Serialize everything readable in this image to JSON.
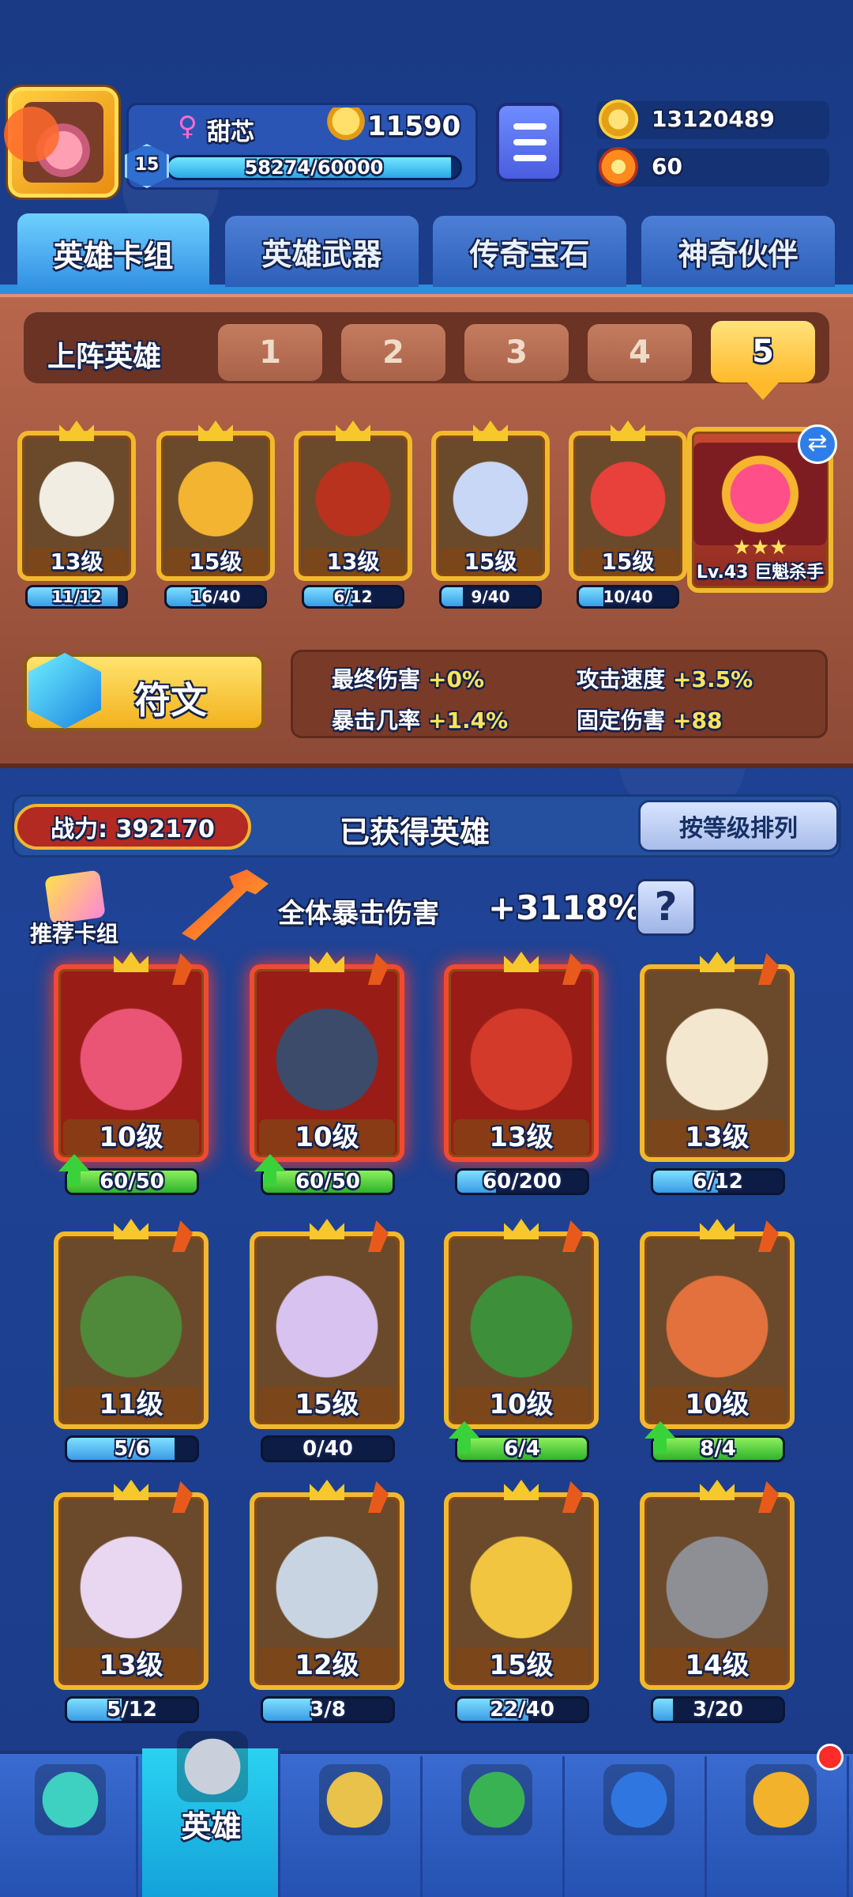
{
  "player": {
    "name": "甜芯",
    "trophies": "11590",
    "level": "15",
    "xp": "58274/60000",
    "xp_fraction": 0.971
  },
  "currency": {
    "gold": "13120489",
    "energy": "60"
  },
  "tabs": [
    "英雄卡组",
    "英雄武器",
    "传奇宝石",
    "神奇伙伴"
  ],
  "lineup": {
    "label": "上阵英雄",
    "slots": [
      "1",
      "2",
      "3",
      "4",
      "5"
    ],
    "active_slot": "5"
  },
  "lineup_heroes": [
    {
      "level": "13级",
      "progress": "11/12",
      "fraction": 0.92,
      "color": "#f1ede2"
    },
    {
      "level": "15级",
      "progress": "16/40",
      "fraction": 0.4,
      "color": "#f3b431"
    },
    {
      "level": "13级",
      "progress": "6/12",
      "fraction": 0.5,
      "color": "#b8321e"
    },
    {
      "level": "15级",
      "progress": "9/40",
      "fraction": 0.22,
      "color": "#c8d7f5"
    },
    {
      "level": "15级",
      "progress": "10/40",
      "fraction": 0.25,
      "color": "#e8403b"
    }
  ],
  "partner": {
    "name": "Lv.43 巨魁杀手",
    "stars": "★★★"
  },
  "rune": {
    "label": "符文"
  },
  "stats": [
    {
      "label": "最终伤害",
      "value": "+0%"
    },
    {
      "label": "攻击速度",
      "value": "+3.5%"
    },
    {
      "label": "暴击几率",
      "value": "+1.4%"
    },
    {
      "label": "固定伤害",
      "value": "+88"
    }
  ],
  "owned": {
    "power": "战力: 392170",
    "title": "已获得英雄",
    "sort": "按等级排列"
  },
  "bonus": {
    "recommend": "推荐卡组",
    "label": "全体暴击伤害",
    "value": "+3118%",
    "help": "?"
  },
  "heroes": [
    {
      "level": "10级",
      "progress": "60/50",
      "fraction": 1.0,
      "upgrade": true,
      "color": "#ea5575",
      "frame": "red"
    },
    {
      "level": "10级",
      "progress": "60/50",
      "fraction": 1.0,
      "upgrade": true,
      "color": "#3c4b69",
      "frame": "red"
    },
    {
      "level": "13级",
      "progress": "60/200",
      "fraction": 0.3,
      "upgrade": false,
      "color": "#d43a2a",
      "frame": "red"
    },
    {
      "level": "13级",
      "progress": "6/12",
      "fraction": 0.5,
      "upgrade": false,
      "color": "#f4e7cf",
      "frame": "gold"
    },
    {
      "level": "11级",
      "progress": "5/6",
      "fraction": 0.83,
      "upgrade": false,
      "color": "#4f8a3b",
      "frame": "gold"
    },
    {
      "level": "15级",
      "progress": "0/40",
      "fraction": 0.0,
      "upgrade": false,
      "color": "#d8c2ef",
      "frame": "gold"
    },
    {
      "level": "10级",
      "progress": "6/4",
      "fraction": 1.0,
      "upgrade": true,
      "color": "#3e8f3a",
      "frame": "gold"
    },
    {
      "level": "10级",
      "progress": "8/4",
      "fraction": 1.0,
      "upgrade": true,
      "color": "#e2713d",
      "frame": "gold"
    },
    {
      "level": "13级",
      "progress": "5/12",
      "fraction": 0.42,
      "upgrade": false,
      "color": "#e9d6f0",
      "frame": "gold"
    },
    {
      "level": "12级",
      "progress": "3/8",
      "fraction": 0.38,
      "upgrade": false,
      "color": "#c9d4e2",
      "frame": "gold"
    },
    {
      "level": "15级",
      "progress": "22/40",
      "fraction": 0.55,
      "upgrade": false,
      "color": "#f2c540",
      "frame": "gold"
    },
    {
      "level": "14级",
      "progress": "3/20",
      "fraction": 0.15,
      "upgrade": false,
      "color": "#8e8f95",
      "frame": "gold"
    }
  ],
  "nav": [
    {
      "icon": "treasure-chest-icon",
      "label": ""
    },
    {
      "icon": "knight-helmet-icon",
      "label": "英雄"
    },
    {
      "icon": "crossed-swords-icon",
      "label": ""
    },
    {
      "icon": "crown-shield-icon",
      "label": ""
    },
    {
      "icon": "guild-banner-icon",
      "label": ""
    },
    {
      "icon": "compass-icon",
      "label": ""
    }
  ]
}
